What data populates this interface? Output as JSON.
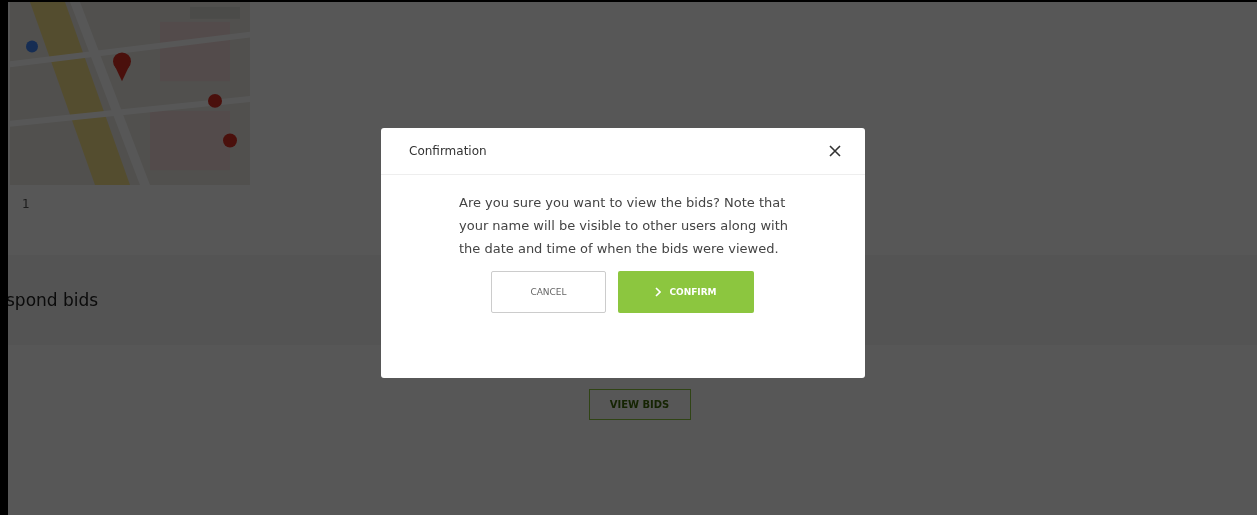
{
  "page": {
    "map_caption": "1",
    "section_heading": "spond bids",
    "view_bids_button": "VIEW BIDS"
  },
  "dialog": {
    "title": "Confirmation",
    "message": "Are you sure you want to view the bids? Note that your name will be visible to other users along with the date and time of when the bids were viewed.",
    "buttons": [
      {
        "label": "CANCEL",
        "kind": "secondary"
      },
      {
        "label": "CONFIRM",
        "kind": "primary"
      }
    ]
  }
}
